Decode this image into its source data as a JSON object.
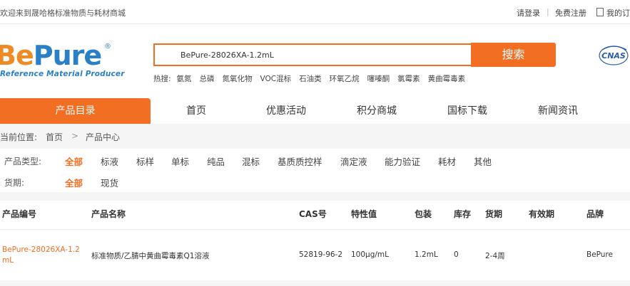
{
  "topbar": {
    "welcome": "欢迎来到晟哈格标准物质与耗材商城",
    "login": "请登录",
    "register": "免费注册",
    "orders": "我的订"
  },
  "logo": {
    "be": "Be",
    "pure": "Pure",
    "reg": "®",
    "subtitle": "Reference Material Producer"
  },
  "search": {
    "value": "BePure-28026XA-1.2mL",
    "button": "搜索"
  },
  "hot": {
    "label": "热搜:",
    "items": [
      "氨氮",
      "总磷",
      "氮氧化物",
      "VOC混标",
      "石油类",
      "环氧乙烷",
      "噻嗪酮",
      "氯霉素",
      "黄曲霉毒素"
    ]
  },
  "cert_badge": "CNAS",
  "nav": {
    "catalog": "产品目录",
    "items": [
      "首页",
      "优惠活动",
      "积分商城",
      "国标下载",
      "新闻资讯"
    ]
  },
  "breadcrumb": {
    "prefix": "当前位置:",
    "home": "首页",
    "current": "产品中心"
  },
  "filters": {
    "type_label": "产品类型:",
    "types": [
      "全部",
      "标液",
      "标样",
      "单标",
      "纯品",
      "混标",
      "基质质控样",
      "滴定液",
      "能力验证",
      "耗材",
      "其他"
    ],
    "delivery_label": "货期:",
    "deliveries": [
      "全部",
      "现货"
    ]
  },
  "table": {
    "headers": [
      "产品编号",
      "产品名称",
      "CAS号",
      "特性值",
      "包装",
      "库存",
      "货期",
      "有效期",
      "品牌"
    ],
    "rows": [
      {
        "code": "BePure-28026XA-1.2mL",
        "name": "标准物质/乙腈中黄曲霉毒素Q1溶液",
        "cas": "52819-96-2",
        "value": "100μg/mL",
        "pack": "1.2mL",
        "stock": "0",
        "lead": "2-4周",
        "expiry": "",
        "brand": "BePure"
      }
    ]
  },
  "colors": {
    "accent": "#f26e22",
    "logo_orange": "#f08a24",
    "logo_blue": "#2a80c7"
  }
}
